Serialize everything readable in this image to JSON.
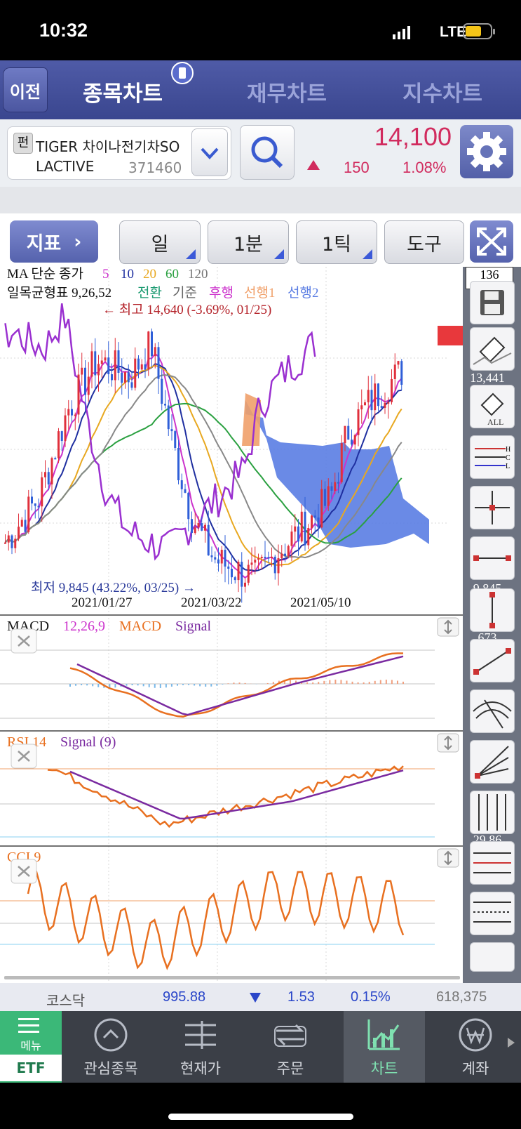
{
  "status_bar": {
    "time": "10:32",
    "network": "LTE"
  },
  "header": {
    "back_label": "이전",
    "tabs": [
      {
        "label": "종목차트",
        "active": true
      },
      {
        "label": "재무차트",
        "active": false
      },
      {
        "label": "지수차트",
        "active": false
      }
    ]
  },
  "stock": {
    "badge": "펀",
    "name_line1": "TIGER 차이나전기차SO",
    "name_line2": "LACTIVE",
    "code": "371460",
    "price": "14,100",
    "change": "150",
    "change_pct": "1.08%",
    "direction": "up"
  },
  "toolbar": {
    "indicator_label": "지표",
    "period_label": "일",
    "minute_label": "1분",
    "tick_label": "1틱",
    "tools_label": "도구"
  },
  "chart": {
    "ma_legend": {
      "title": "MA 단순 종가",
      "periods": [
        "5",
        "10",
        "20",
        "60",
        "120"
      ]
    },
    "ichimoku_legend": {
      "title": "일목균형표 9,26,52",
      "items": [
        "전환",
        "기준",
        "후행",
        "선행1",
        "선행2"
      ]
    },
    "high_note": "← 최고 14,640 (-3.69%, 01/25)",
    "low_note": "최저 9,845 (43.22%, 03/25) →",
    "x_dates": [
      "2021/01/27",
      "2021/03/22",
      "2021/05/10"
    ],
    "y_labels": [
      "136",
      "13,441",
      "9,845",
      "673",
      "29.86"
    ],
    "macd_legend": {
      "title": "MACD",
      "params": "12,26,9",
      "line": "MACD",
      "signal": "Signal"
    },
    "rsi_legend": {
      "title": "RSI 14",
      "signal": "Signal (9)"
    },
    "cci_legend": {
      "title": "CCI 9"
    },
    "colors": {
      "up": "#e0303c",
      "down": "#2f5fd8",
      "ma5": "#cc33cc",
      "ma10": "#1f2fa0",
      "ma20": "#e8a820",
      "ma60": "#2aa040",
      "ma120": "#888888",
      "cloud": "#5577e0",
      "macd": "#e87020",
      "signal": "#7a2aa0"
    }
  },
  "chart_data": [
    {
      "type": "line",
      "title": "MA 단순 종가",
      "x": [
        "2021/01/27",
        "2021/03/22",
        "2021/05/10"
      ],
      "series": [
        {
          "name": "5",
          "values": [
            13800,
            10200,
            12000
          ]
        },
        {
          "name": "10",
          "values": [
            13700,
            10100,
            11900
          ]
        },
        {
          "name": "20",
          "values": [
            13600,
            10300,
            11600
          ]
        },
        {
          "name": "60",
          "values": [
            12600,
            11600,
            11400
          ]
        },
        {
          "name": "120",
          "values": [
            13200,
            10800,
            11200
          ]
        }
      ],
      "annotations": [
        "최고 14,640 (-3.69%, 01/25)",
        "최저 9,845 (43.22%, 03/25)"
      ]
    },
    {
      "type": "line",
      "title": "MACD",
      "series": [
        {
          "name": "MACD",
          "values": [
            0.4,
            -0.9,
            0.1,
            0.8
          ]
        },
        {
          "name": "Signal",
          "values": [
            0.5,
            -0.8,
            0.0,
            0.7
          ]
        }
      ]
    },
    {
      "type": "line",
      "title": "RSI 14",
      "series": [
        {
          "name": "RSI",
          "values": [
            80,
            30,
            55,
            80
          ]
        },
        {
          "name": "Signal (9)",
          "values": [
            75,
            35,
            50,
            76
          ]
        }
      ]
    },
    {
      "type": "line",
      "title": "CCI 9",
      "series": [
        {
          "name": "CCI",
          "values": [
            150,
            -120,
            160,
            80
          ]
        }
      ]
    }
  ],
  "index_bar": {
    "name": "코스닥",
    "value": "995.88",
    "change": "1.53",
    "change_pct": "0.15%",
    "volume": "618,375"
  },
  "nav": {
    "items": [
      {
        "label": "ETF",
        "top": "메뉴",
        "icon": "menu-icon"
      },
      {
        "label": "관심종목",
        "icon": "favorites-icon"
      },
      {
        "label": "현재가",
        "icon": "price-icon"
      },
      {
        "label": "주문",
        "icon": "order-icon"
      },
      {
        "label": "차트",
        "icon": "chart-icon"
      },
      {
        "label": "계좌",
        "icon": "account-icon"
      }
    ]
  }
}
